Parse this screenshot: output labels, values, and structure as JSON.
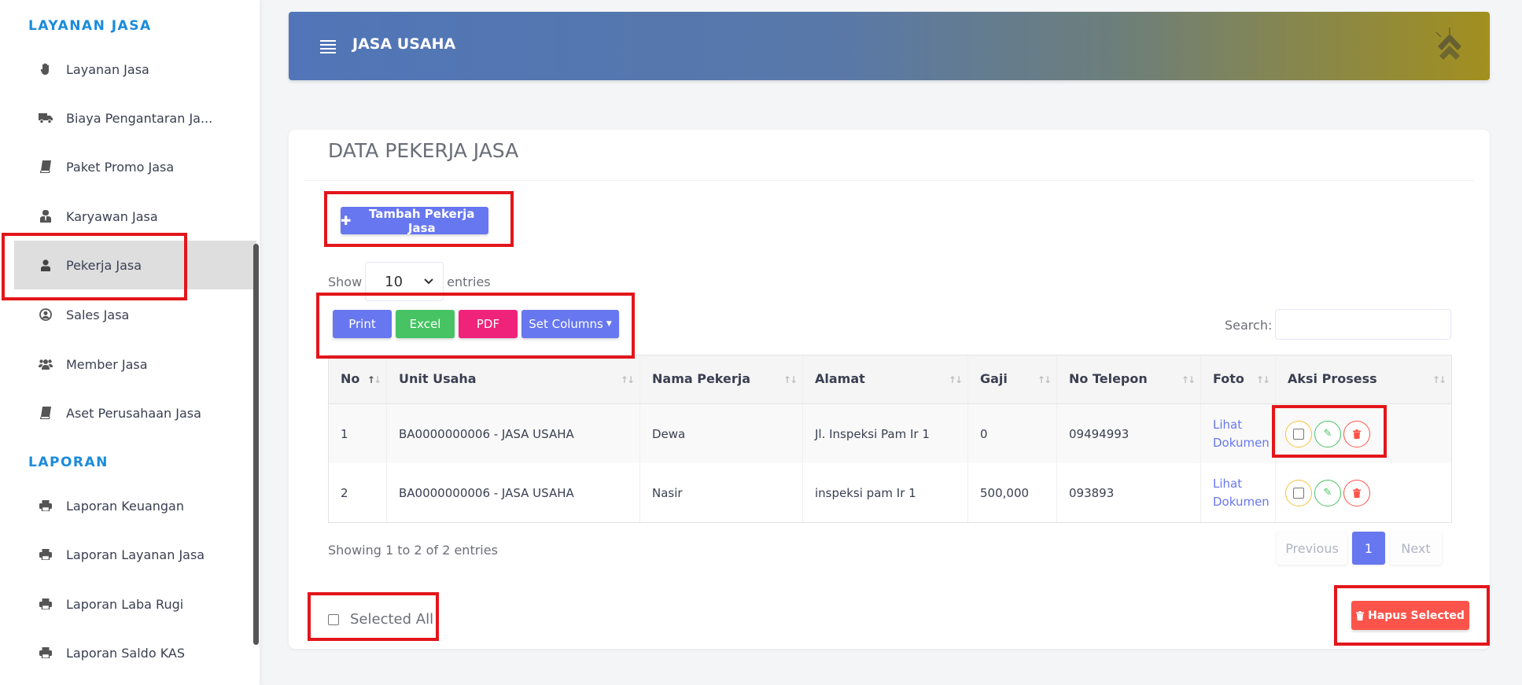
{
  "sidebar": {
    "section_jasa": "LAYANAN JASA",
    "section_laporan": "LAPORAN",
    "items": [
      {
        "label": "Layanan Jasa",
        "icon": "hand-icon"
      },
      {
        "label": "Biaya Pengantaran Ja...",
        "icon": "truck-icon"
      },
      {
        "label": "Paket Promo Jasa",
        "icon": "book-icon"
      },
      {
        "label": "Karyawan Jasa",
        "icon": "user-tie-icon"
      },
      {
        "label": "Pekerja Jasa",
        "icon": "user-icon"
      },
      {
        "label": "Sales Jasa",
        "icon": "user-circle-icon"
      },
      {
        "label": "Member Jasa",
        "icon": "users-icon"
      },
      {
        "label": "Aset Perusahaan Jasa",
        "icon": "book-icon"
      }
    ],
    "reports": [
      {
        "label": "Laporan Keuangan",
        "icon": "print-icon"
      },
      {
        "label": "Laporan Layanan Jasa",
        "icon": "print-icon"
      },
      {
        "label": "Laporan Laba Rugi",
        "icon": "print-icon"
      },
      {
        "label": "Laporan Saldo KAS",
        "icon": "print-icon"
      }
    ]
  },
  "header": {
    "title": "JASA USAHA"
  },
  "card": {
    "title": "DATA PEKERJA JASA",
    "add_button": "Tambah Pekerja Jasa",
    "show_label": "Show",
    "entries_value": "10",
    "entries_label": "entries",
    "print_button": "Print",
    "excel_button": "Excel",
    "pdf_button": "PDF",
    "columns_button": "Set Columns",
    "search_label": "Search:",
    "search_value": ""
  },
  "table": {
    "headers": [
      "No",
      "Unit Usaha",
      "Nama Pekerja",
      "Alamat",
      "Gaji",
      "No Telepon",
      "Foto",
      "Aksi Prosess"
    ],
    "rows": [
      {
        "no": "1",
        "unit": "BA0000000006 - JASA USAHA",
        "nama": "Dewa",
        "alamat": "Jl. Inspeksi Pam Ir 1",
        "gaji": "0",
        "telepon": "09494993",
        "foto_line1": "Lihat",
        "foto_line2": "Dokumen"
      },
      {
        "no": "2",
        "unit": "BA0000000006 - JASA USAHA",
        "nama": "Nasir",
        "alamat": "inspeksi pam Ir 1",
        "gaji": "500,000",
        "telepon": "093893",
        "foto_line1": "Lihat",
        "foto_line2": "Dokumen"
      }
    ]
  },
  "footer": {
    "info": "Showing 1 to 2 of 2 entries",
    "previous": "Previous",
    "page": "1",
    "next": "Next",
    "select_all": "Selected All",
    "delete_selected": "Hapus Selected"
  },
  "colors": {
    "accent": "#6777ef",
    "success": "#47c363",
    "danger": "#fc544b",
    "pdf": "#f0237a",
    "section": "#1a8bdc",
    "highlight": "#e2161b"
  }
}
